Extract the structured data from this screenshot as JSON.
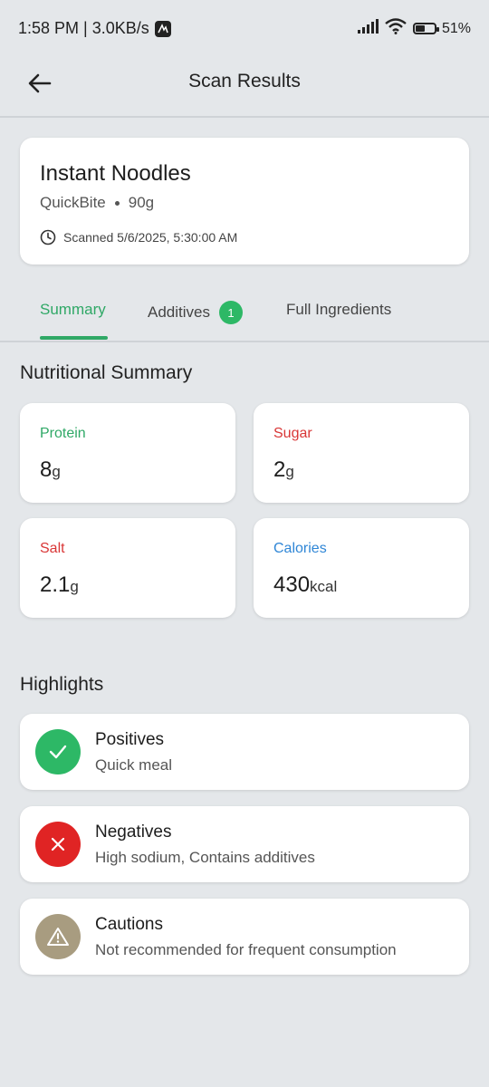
{
  "status_bar": {
    "time_speed": "1:58 PM | 3.0KB/s",
    "battery": "51%",
    "battery_level": 0.51
  },
  "app_bar": {
    "title": "Scan Results"
  },
  "product": {
    "name": "Instant Noodles",
    "brand": "QuickBite",
    "weight": "90g",
    "scanned": "Scanned 5/6/2025, 5:30:00 AM"
  },
  "tabs": [
    {
      "label": "Summary",
      "active": true
    },
    {
      "label": "Additives",
      "badge": "1"
    },
    {
      "label": "Full Ingredients"
    }
  ],
  "nutrition": {
    "title": "Nutritional Summary",
    "items": [
      {
        "label": "Protein",
        "value": "8",
        "unit": "g",
        "color": "#2fa866"
      },
      {
        "label": "Sugar",
        "value": "2",
        "unit": "g",
        "color": "#d93636"
      },
      {
        "label": "Salt",
        "value": "2.1",
        "unit": "g",
        "color": "#d93636"
      },
      {
        "label": "Calories",
        "value": "430",
        "unit": "kcal",
        "color": "#2f86d6"
      }
    ]
  },
  "highlights": {
    "title": "Highlights",
    "items": [
      {
        "title": "Positives",
        "desc": "Quick meal",
        "icon": "check-icon",
        "color": "#2db866"
      },
      {
        "title": "Negatives",
        "desc": "High sodium, Contains additives",
        "icon": "close-icon",
        "color": "#e02424"
      },
      {
        "title": "Cautions",
        "desc": "Not recommended for frequent consumption",
        "icon": "warning-icon",
        "color": "#a89c80"
      }
    ]
  }
}
